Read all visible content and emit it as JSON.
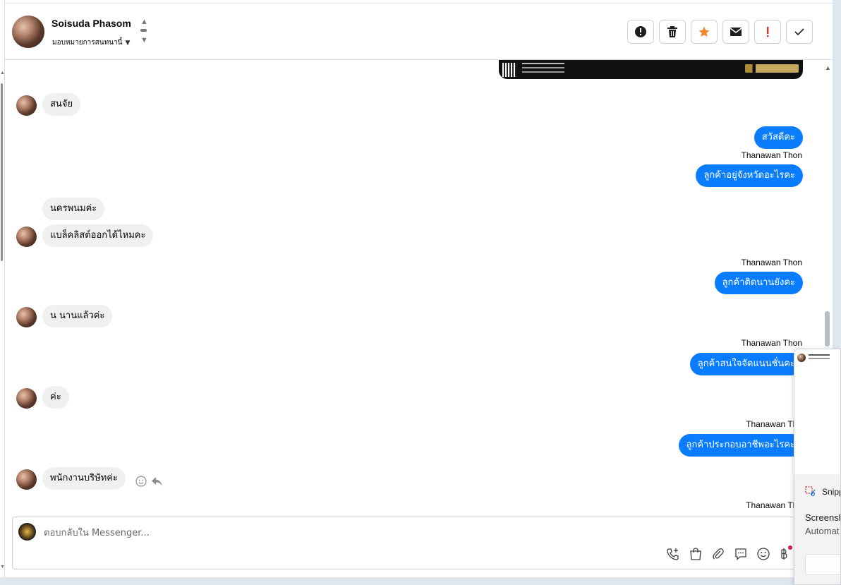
{
  "header": {
    "contact_name": "Soisuda Phasom",
    "assign_label": "มอบหมายการสนทนานี้",
    "actions": [
      {
        "name": "report-button",
        "icon": "alert-circle-icon"
      },
      {
        "name": "delete-button",
        "icon": "trash-icon"
      },
      {
        "name": "star-button",
        "icon": "star-icon"
      },
      {
        "name": "mark-unread-button",
        "icon": "envelope-icon"
      },
      {
        "name": "priority-button",
        "icon": "exclamation-icon"
      },
      {
        "name": "done-button",
        "icon": "check-icon"
      }
    ]
  },
  "messages": {
    "m1": "สนจัย",
    "m2": "สวัสดีคะ",
    "m3_sender": "Thanawan Thon",
    "m3": "ลูกค้าอยู่จังหวัดอะไรคะ",
    "m4": "นครพนมค่ะ",
    "m5": "แบล็คลิสต์ออกได้ไหมคะ",
    "m6_sender": "Thanawan Thon",
    "m6": "ลูกค้าติดนานยังคะ",
    "m7": "น นานแล้วค่ะ",
    "m8_sender": "Thanawan Thon",
    "m8": "ลูกค้าสนใจจัดแนนชั่นคะ",
    "m9": "ค่ะ",
    "m10_sender": "Thanawan Tho",
    "m10": "ลูกค้าประกอบอาชีพอะไรคะ",
    "m11": "พนักงานบริษัทค่ะ",
    "m12_sender": "Thanawan Tho"
  },
  "composer": {
    "placeholder": "ตอบกลับใน Messenger..."
  },
  "notification": {
    "app_name": "Snipp",
    "title": "Screensh",
    "body": "Automat"
  },
  "colors": {
    "outgoing_bubble": "#0a7cff",
    "incoming_bubble": "#f0f0f0",
    "star_accent": "#f0872b",
    "priority_accent": "#e0302a"
  }
}
